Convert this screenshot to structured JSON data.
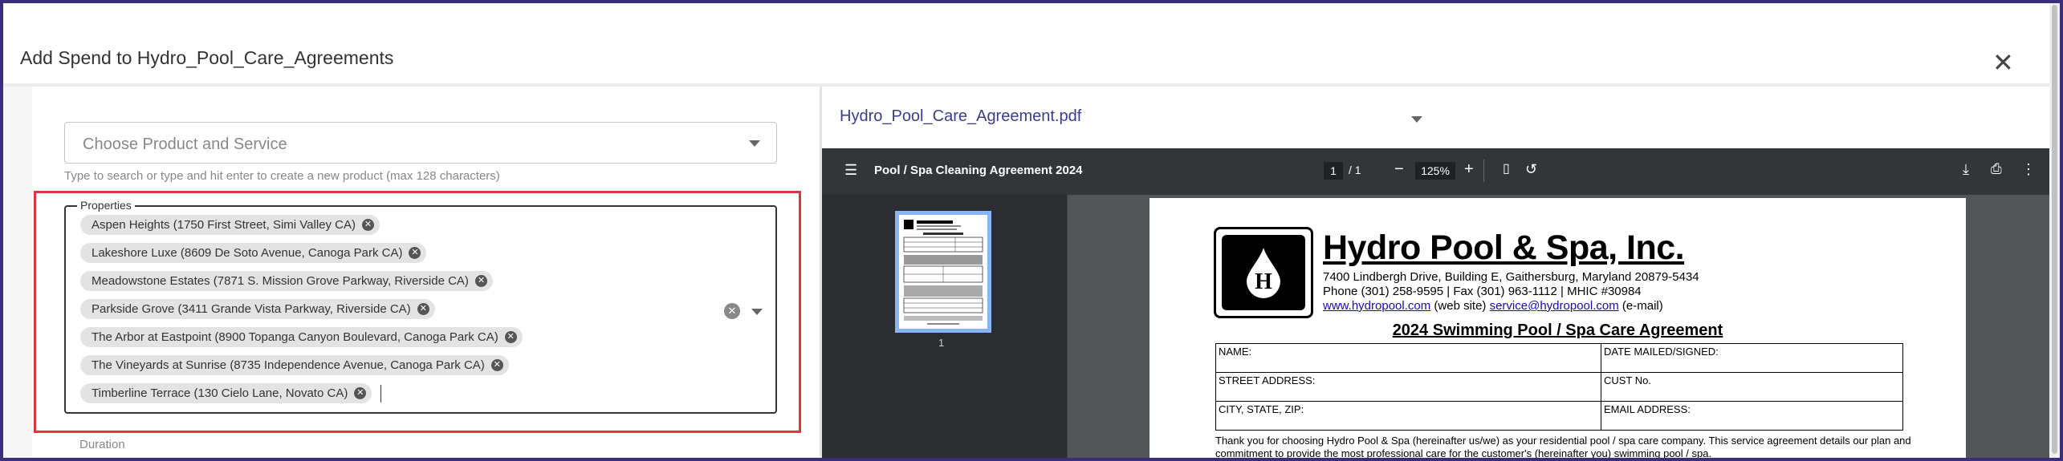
{
  "dialog": {
    "title": "Add Spend to Hydro_Pool_Care_Agreements",
    "close_icon": "close-icon"
  },
  "form": {
    "product_placeholder": "Choose Product and Service",
    "product_hint": "Type to search or type and hit enter to create a new product (max 128 characters)",
    "properties_label": "Properties",
    "properties": [
      "Aspen Heights (1750 First Street, Simi Valley CA)",
      "Lakeshore Luxe (8609 De Soto Avenue, Canoga Park CA)",
      "Meadowstone Estates (7871 S. Mission Grove Parkway, Riverside CA)",
      "Parkside Grove (3411 Grande Vista Parkway, Riverside CA)",
      "The Arbor at Eastpoint (8900 Topanga Canyon Boulevard, Canoga Park CA)",
      "The Vineyards at Sunrise (8735 Independence Avenue, Canoga Park CA)",
      "Timberline Terrace (130 Cielo Lane, Novato CA)"
    ],
    "duration_label": "Duration",
    "highlight_color": "#d9383e"
  },
  "viewer": {
    "file_name": "Hydro_Pool_Care_Agreement.pdf",
    "doc_title": "Pool / Spa Cleaning Agreement 2024",
    "page_current": "1",
    "page_total": "/ 1",
    "zoom": "125%",
    "thumb_page": "1"
  },
  "pdf": {
    "company": "Hydro Pool & Spa, Inc.",
    "address": "7400 Lindbergh Drive, Building E, Gaithersburg, Maryland 20879-5434",
    "phone": "Phone (301) 258-9595 | Fax (301) 963-1112 | MHIC #30984",
    "website": "www.hydropool.com",
    "website_suffix": " (web site) ",
    "email": "service@hydropool.com",
    "email_suffix": " (e-mail)",
    "agreement_title": "2024 Swimming Pool / Spa Care Agreement",
    "fields": {
      "name": "NAME:",
      "date": "DATE MAILED/SIGNED:",
      "street": "STREET ADDRESS:",
      "cust": "CUST No.",
      "city": "CITY, STATE, ZIP:",
      "email": "EMAIL ADDRESS:"
    },
    "intro": "Thank you for choosing Hydro Pool & Spa (hereinafter us/we) as your residential pool / spa care company. This service agreement details our plan and commitment to provide the most professional care for the customer's (hereinafter you) swimming pool / spa."
  }
}
